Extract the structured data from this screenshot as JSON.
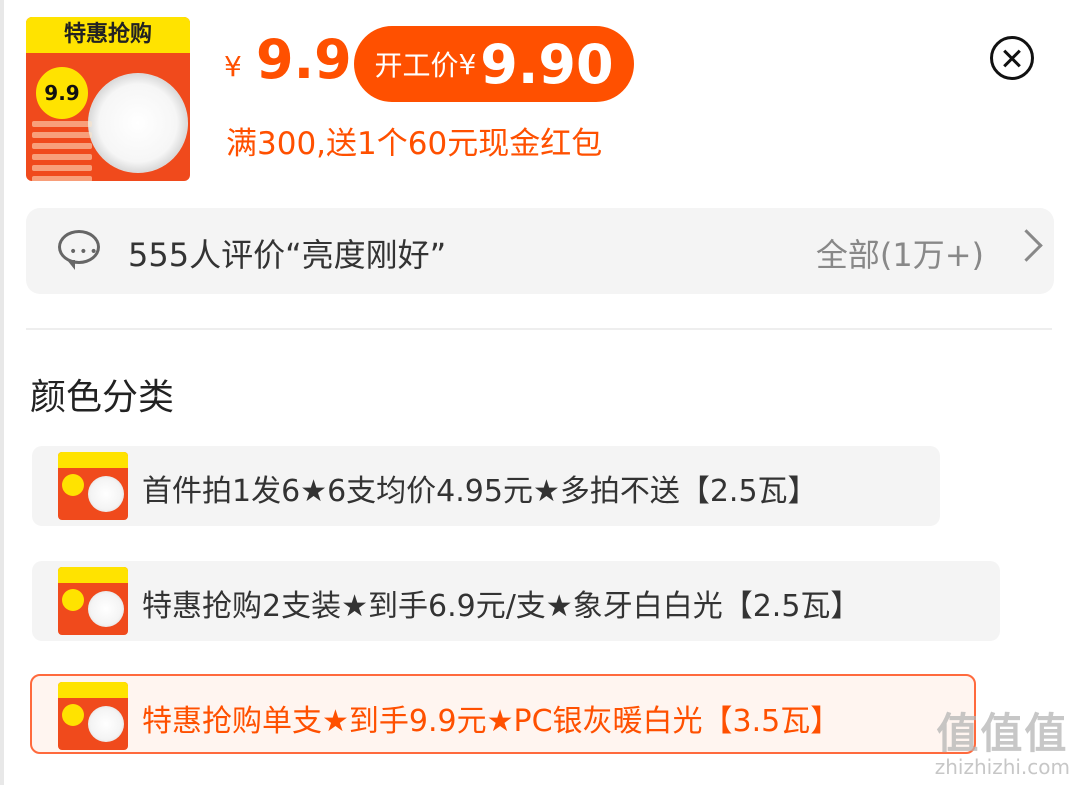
{
  "product": {
    "thumbnail_banner": "特惠抢购",
    "thumbnail_badge": "9.9",
    "currency": "¥",
    "price": "9.9",
    "promo_label": "开工价",
    "promo_currency": "¥",
    "promo_price": "9.90",
    "subsidy": "满300,送1个60元现金红包"
  },
  "reviews": {
    "summary": "555人评价“亮度刚好”",
    "all_label": "全部(1万+)"
  },
  "sku_section": {
    "title": "颜色分类",
    "items": [
      {
        "label": "首件拍1发6★6支均价4.95元★多拍不送【2.5瓦】",
        "selected": false
      },
      {
        "label": "特惠抢购2支装★到手6.9元/支★象牙白白光【2.5瓦】",
        "selected": false
      },
      {
        "label": "特惠抢购单支★到手9.9元★PC银灰暖白光【3.5瓦】",
        "selected": true
      }
    ]
  },
  "watermark": {
    "main": "值值值",
    "sub": "zhizhizhi.com"
  },
  "colors": {
    "accent": "#ff5000",
    "badge_yellow": "#ffe300",
    "panel": "#f4f4f4"
  }
}
